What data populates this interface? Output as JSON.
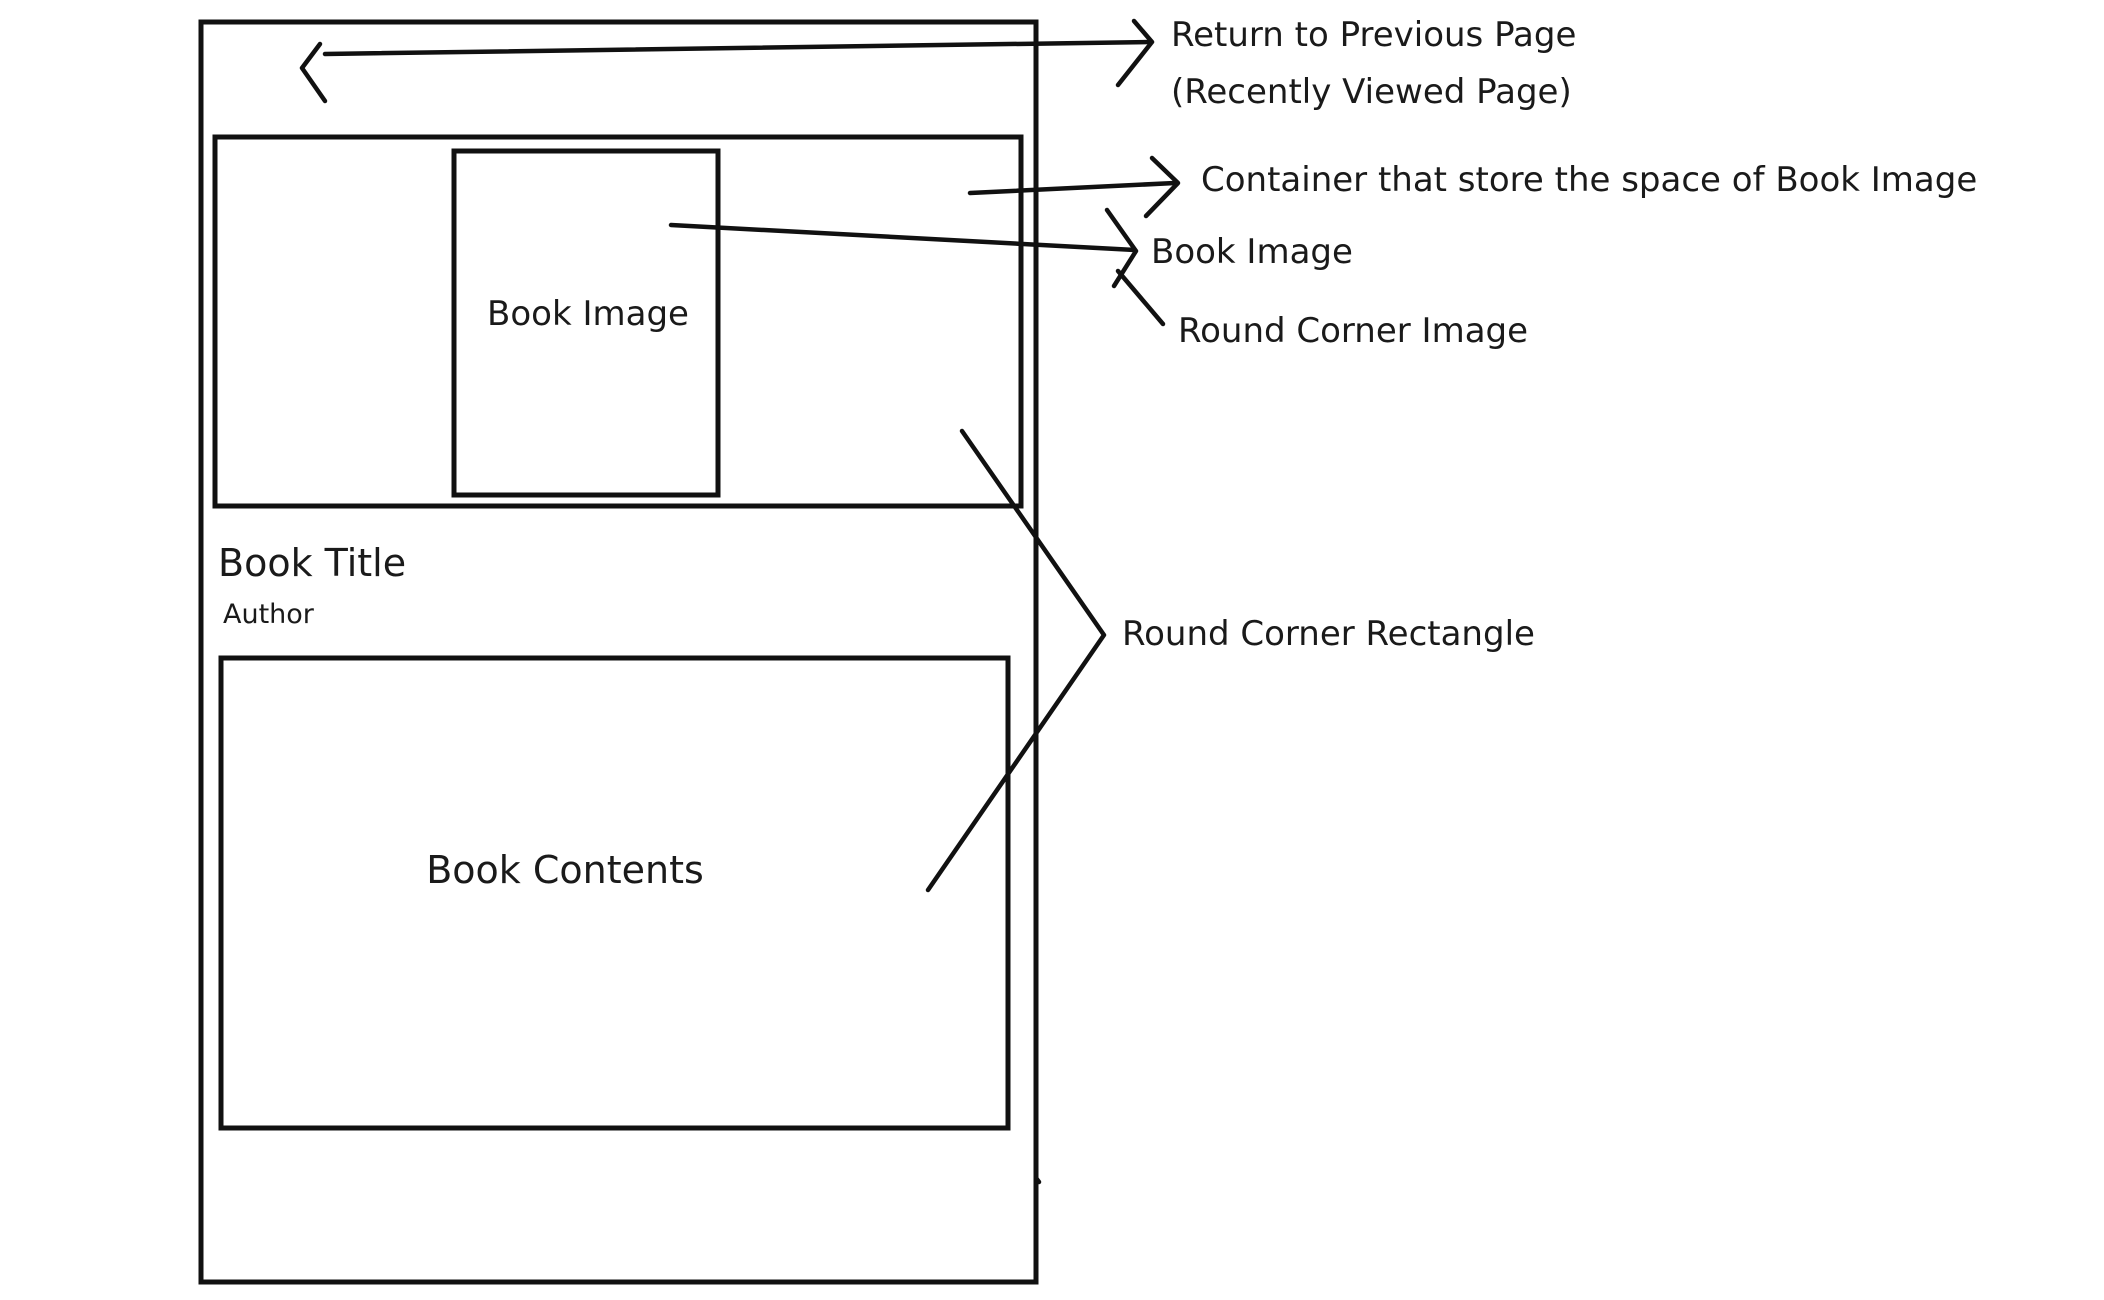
{
  "wireframe": {
    "book_image_label": "Book Image",
    "book_title": "Book Title",
    "author": "Author",
    "book_contents": "Book Contents"
  },
  "annotations": {
    "return_line1": "Return to Previous Page",
    "return_line2": "(Recently Viewed Page)",
    "container": "Container that store the space of Book Image",
    "book_image": "Book Image",
    "round_corner_image": "Round Corner Image",
    "round_corner_rectangle": "Round Corner Rectangle"
  },
  "icons": {
    "back": "chevron-left-icon"
  },
  "colors": {
    "ink": "#111111",
    "background": "#ffffff"
  }
}
